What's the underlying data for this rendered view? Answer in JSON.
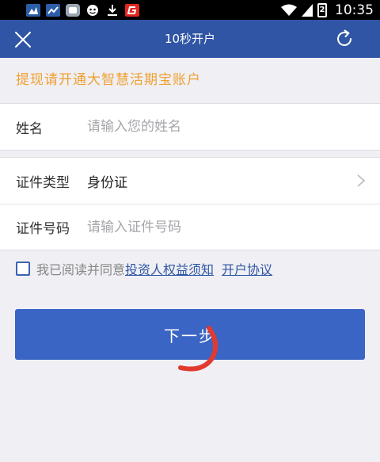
{
  "status_bar": {
    "time": "10:35",
    "battery_level": "2"
  },
  "nav": {
    "title": "10秒开户"
  },
  "notice": "提现请开通大智慧活期宝账户",
  "form": {
    "name_label": "姓名",
    "name_placeholder": "请输入您的姓名",
    "id_type_label": "证件类型",
    "id_type_value": "身份证",
    "id_number_label": "证件号码",
    "id_number_placeholder": "请输入证件号码"
  },
  "agreement": {
    "text": "我已阅读并同意",
    "link1": "投资人权益须知",
    "link2": "开户协议",
    "checked": false
  },
  "next_button": "下一步",
  "colors": {
    "nav_bg": "#2f55a4",
    "notice_text": "#f0a030",
    "button_bg": "#3a65c4",
    "link": "#2f55a4"
  }
}
